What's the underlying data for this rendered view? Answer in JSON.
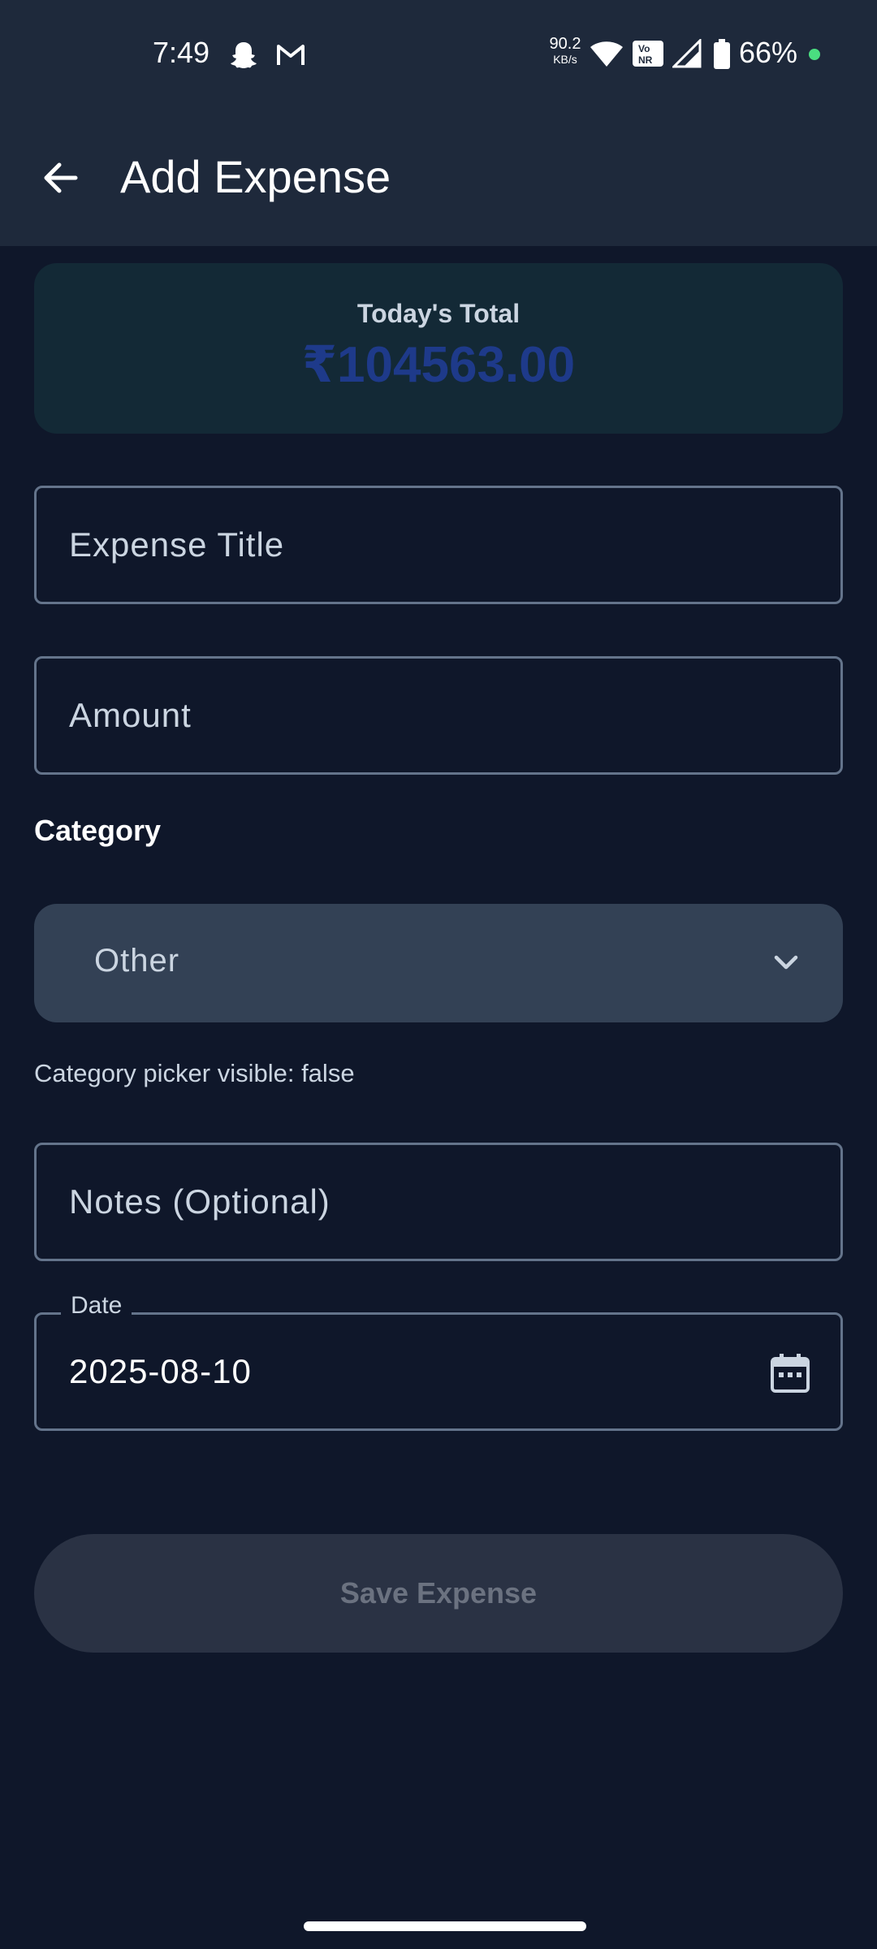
{
  "status_bar": {
    "time": "7:49",
    "net_speed_value": "90.2",
    "net_speed_unit": "KB/s",
    "battery_percent": "66%",
    "dot_color": "#4ade80",
    "icons": [
      "snapchat-icon",
      "gmail-icon",
      "wifi-icon",
      "volte-icon",
      "signal-icon",
      "battery-icon"
    ]
  },
  "app_bar": {
    "title": "Add Expense",
    "back_icon": "arrow-left-icon"
  },
  "summary": {
    "label": "Today's Total",
    "value": "₹104563.00",
    "value_color": "#1e3a8a"
  },
  "form": {
    "title_placeholder": "Expense Title",
    "amount_placeholder": "Amount",
    "category_label": "Category",
    "category_selected": "Other",
    "picker_note": "Category picker visible: false",
    "notes_placeholder": "Notes (Optional)",
    "date_label": "Date",
    "date_value": "2025-08-10",
    "save_label": "Save Expense"
  }
}
